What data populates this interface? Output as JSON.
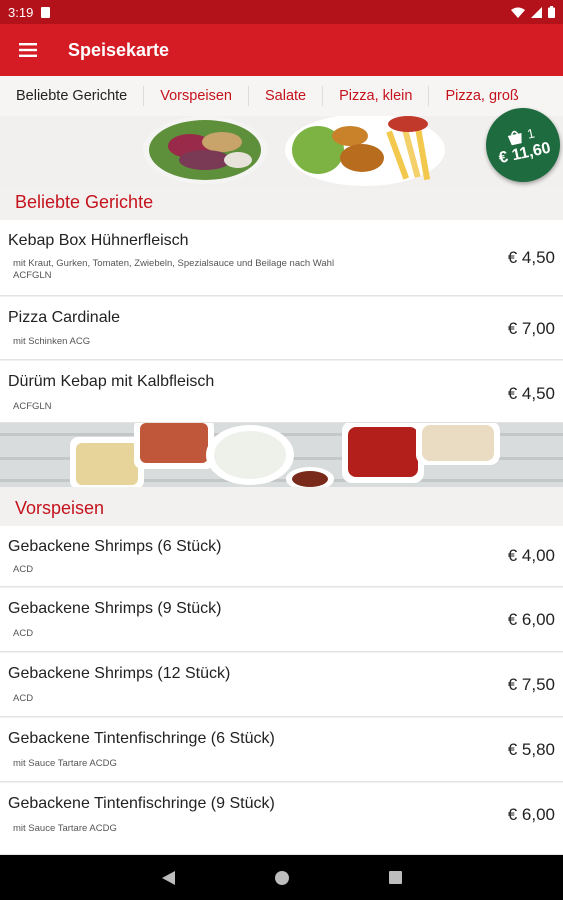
{
  "status": {
    "time": "3:19"
  },
  "appbar": {
    "title": "Speisekarte"
  },
  "tabs": [
    {
      "label": "Beliebte Gerichte"
    },
    {
      "label": "Vorspeisen"
    },
    {
      "label": "Salate"
    },
    {
      "label": "Pizza, klein"
    },
    {
      "label": "Pizza, groß"
    }
  ],
  "cart": {
    "count": "1",
    "total": "€ 11,60"
  },
  "sections": [
    {
      "title": "Beliebte Gerichte",
      "items": [
        {
          "name": "Kebap Box Hühnerfleisch",
          "desc": "mit Kraut, Gurken, Tomaten, Zwiebeln, Spezialsauce und Beilage nach Wahl",
          "allergens": "ACFGLN",
          "price": "€ 4,50"
        },
        {
          "name": "Pizza Cardinale",
          "desc": "mit Schinken ACG",
          "price": "€ 7,00"
        },
        {
          "name": "Dürüm Kebap mit Kalbfleisch",
          "desc": "ACFGLN",
          "price": "€ 4,50"
        }
      ]
    },
    {
      "title": "Vorspeisen",
      "items": [
        {
          "name": "Gebackene Shrimps (6 Stück)",
          "desc": "ACD",
          "price": "€ 4,00"
        },
        {
          "name": "Gebackene Shrimps (9 Stück)",
          "desc": "ACD",
          "price": "€ 6,00"
        },
        {
          "name": "Gebackene Shrimps (12 Stück)",
          "desc": "ACD",
          "price": "€ 7,50"
        },
        {
          "name": "Gebackene Tintenfischringe (6 Stück)",
          "desc": "mit Sauce Tartare ACDG",
          "price": "€ 5,80"
        },
        {
          "name": "Gebackene Tintenfischringe (9 Stück)",
          "desc": "mit Sauce Tartare ACDG",
          "price": "€ 6,00"
        }
      ]
    }
  ],
  "colors": {
    "brand": "#d51b24",
    "statusbar": "#b4121b",
    "cart": "#1d6b3e",
    "accent_text": "#c4131c"
  },
  "icons": [
    "sd-card-icon",
    "wifi-icon",
    "signal-icon",
    "battery-icon",
    "menu-icon",
    "shopping-bag-icon",
    "back-icon",
    "home-icon",
    "recents-icon"
  ]
}
